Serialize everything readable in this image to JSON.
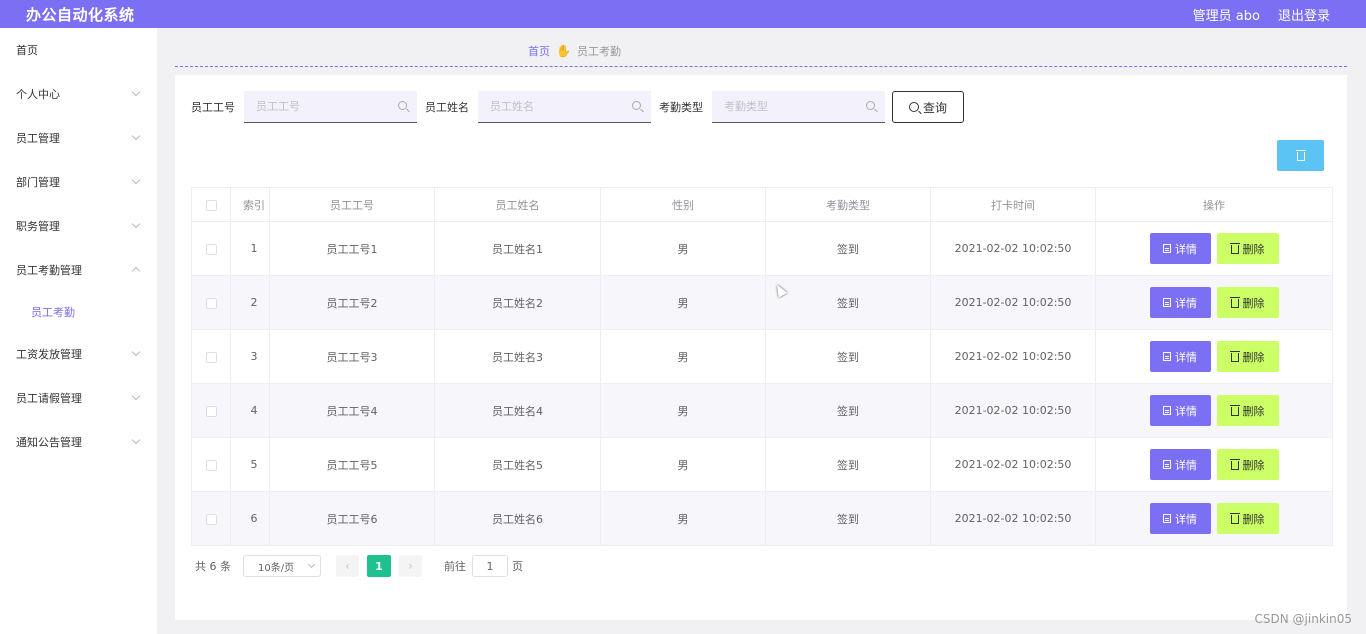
{
  "header": {
    "app_title": "办公自动化系统",
    "user_label": "管理员 abo",
    "logout_label": "退出登录"
  },
  "sidebar": {
    "items": [
      {
        "label": "首页",
        "has_arrow": false
      },
      {
        "label": "个人中心",
        "has_arrow": true
      },
      {
        "label": "员工管理",
        "has_arrow": true
      },
      {
        "label": "部门管理",
        "has_arrow": true
      },
      {
        "label": "职务管理",
        "has_arrow": true
      },
      {
        "label": "员工考勤管理",
        "has_arrow": true,
        "expanded": true
      },
      {
        "label": "工资发放管理",
        "has_arrow": true
      },
      {
        "label": "员工请假管理",
        "has_arrow": true
      },
      {
        "label": "通知公告管理",
        "has_arrow": true
      }
    ],
    "sub_item": "员工考勤"
  },
  "breadcrumb": {
    "home": "首页",
    "separator_icon": "hand-icon",
    "current": "员工考勤"
  },
  "filters": {
    "emp_no_label": "员工工号",
    "emp_no_placeholder": "员工工号",
    "emp_name_label": "员工姓名",
    "emp_name_placeholder": "员工姓名",
    "type_label": "考勤类型",
    "type_placeholder": "考勤类型",
    "search_label": "查询"
  },
  "table": {
    "headers": [
      "索引",
      "员工工号",
      "员工姓名",
      "性别",
      "考勤类型",
      "打卡时间",
      "操作"
    ],
    "rows": [
      {
        "index": "1",
        "emp_no": "员工工号1",
        "name": "员工姓名1",
        "gender": "男",
        "type": "签到",
        "time": "2021-02-02 10:02:50"
      },
      {
        "index": "2",
        "emp_no": "员工工号2",
        "name": "员工姓名2",
        "gender": "男",
        "type": "签到",
        "time": "2021-02-02 10:02:50"
      },
      {
        "index": "3",
        "emp_no": "员工工号3",
        "name": "员工姓名3",
        "gender": "男",
        "type": "签到",
        "time": "2021-02-02 10:02:50"
      },
      {
        "index": "4",
        "emp_no": "员工工号4",
        "name": "员工姓名4",
        "gender": "男",
        "type": "签到",
        "time": "2021-02-02 10:02:50"
      },
      {
        "index": "5",
        "emp_no": "员工工号5",
        "name": "员工姓名5",
        "gender": "男",
        "type": "签到",
        "time": "2021-02-02 10:02:50"
      },
      {
        "index": "6",
        "emp_no": "员工工号6",
        "name": "员工姓名6",
        "gender": "男",
        "type": "签到",
        "time": "2021-02-02 10:02:50"
      }
    ],
    "detail_label": "详情",
    "delete_label": "删除"
  },
  "pagination": {
    "total": "共 6 条",
    "page_size": "10条/页",
    "current_page": "1",
    "goto_label": "前往",
    "goto_value": "1",
    "page_suffix": "页"
  },
  "watermark": "CSDN @jinkin05",
  "colors": {
    "primary": "#7b6ff3",
    "delete_button": "#ccff66",
    "batch_delete": "#5bc4f5",
    "active_page": "#1fc18f"
  }
}
